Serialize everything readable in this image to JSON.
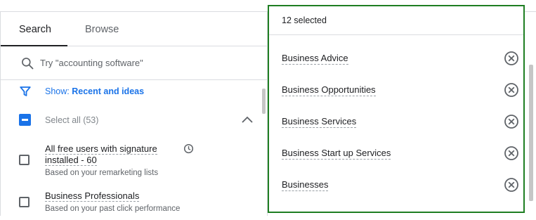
{
  "tabs": [
    {
      "label": "Search",
      "active": true
    },
    {
      "label": "Browse",
      "active": false
    }
  ],
  "search": {
    "placeholder": "Try \"accounting software\""
  },
  "filter": {
    "prefix": "Show:",
    "value": "Recent and ideas"
  },
  "select_all": {
    "label": "Select all (53)",
    "state": "indeterminate"
  },
  "items": [
    {
      "title_line1": "All free users with signature",
      "title_line2": "installed - 60",
      "subtitle": "Based on your remarketing lists",
      "icon": "clock-icon",
      "checked": false
    },
    {
      "title_line1": "Business Professionals",
      "subtitle": "Based on your past click performance",
      "checked": false
    }
  ],
  "selected": {
    "count_label": "12 selected",
    "items": [
      "Business Advice",
      "Business Opportunities",
      "Business Services",
      "Business Start up Services",
      "Businesses"
    ]
  },
  "colors": {
    "accent": "#1a73e8",
    "highlight_border": "#1e7e22"
  }
}
